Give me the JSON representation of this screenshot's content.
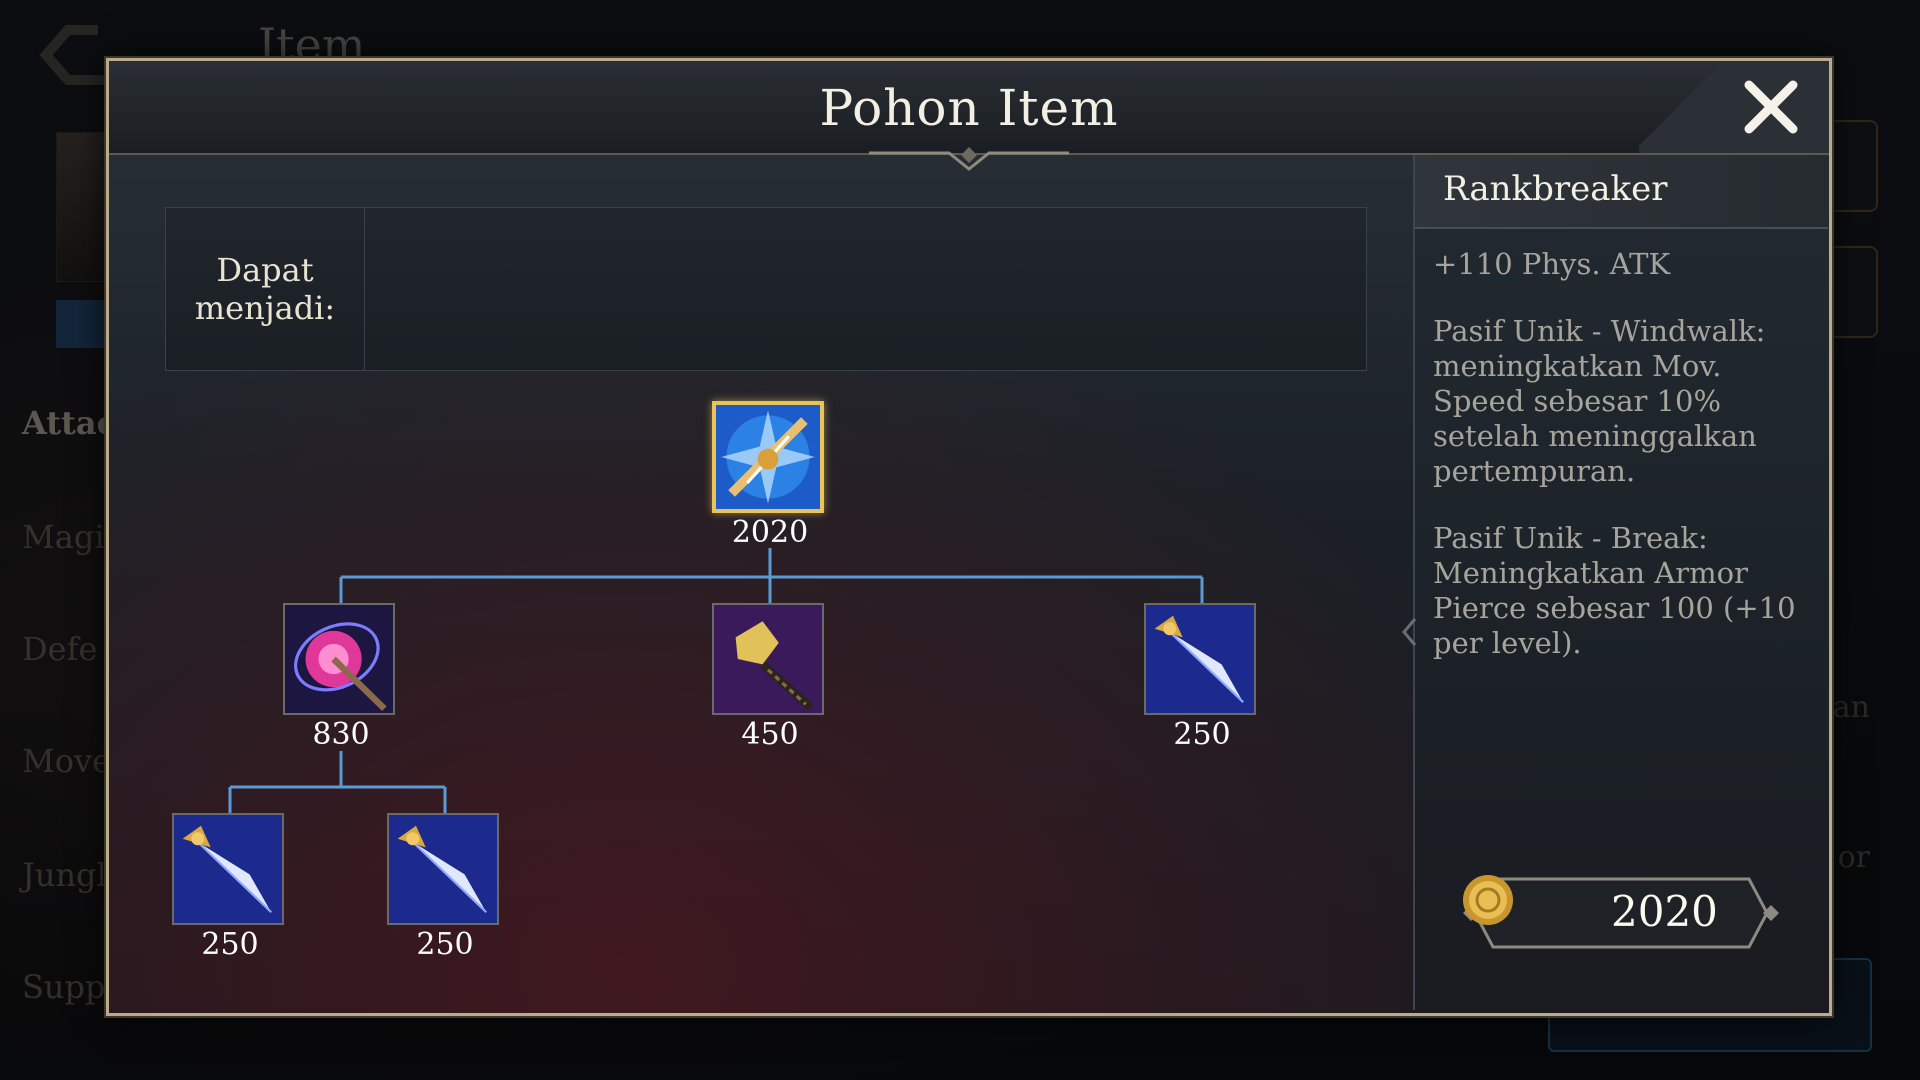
{
  "background": {
    "title": "Item",
    "categories": [
      "Attac",
      "Magic",
      "Defe",
      "Move",
      "Jungl",
      "Supp"
    ],
    "right_text": [
      "an",
      "or"
    ]
  },
  "dialog": {
    "title": "Pohon Item",
    "can_become_label": "Dapat menjadi:"
  },
  "tree": {
    "root": {
      "price": "2020",
      "icon": "rankbreaker-icon"
    },
    "level2": [
      {
        "price": "830",
        "icon": "magic-orb-icon"
      },
      {
        "price": "450",
        "icon": "hammer-icon"
      },
      {
        "price": "250",
        "icon": "dagger-icon"
      }
    ],
    "level3": [
      {
        "price": "250",
        "icon": "dagger-icon"
      },
      {
        "price": "250",
        "icon": "dagger-icon"
      }
    ]
  },
  "detail": {
    "name": "Rankbreaker",
    "stat": "+110 Phys. ATK",
    "passive1": "Pasif Unik - Windwalk: meningkatkan Mov. Speed sebesar 10% setelah meninggalkan pertempuran.",
    "passive2": "Pasif Unik - Break: Meningkatkan Armor Pierce sebesar 100 (+10 per level).",
    "price": "2020"
  },
  "colors": {
    "frame": "#b9ab8c",
    "tree_line": "#5b9bd5",
    "selected_border": "#e7c55a"
  }
}
